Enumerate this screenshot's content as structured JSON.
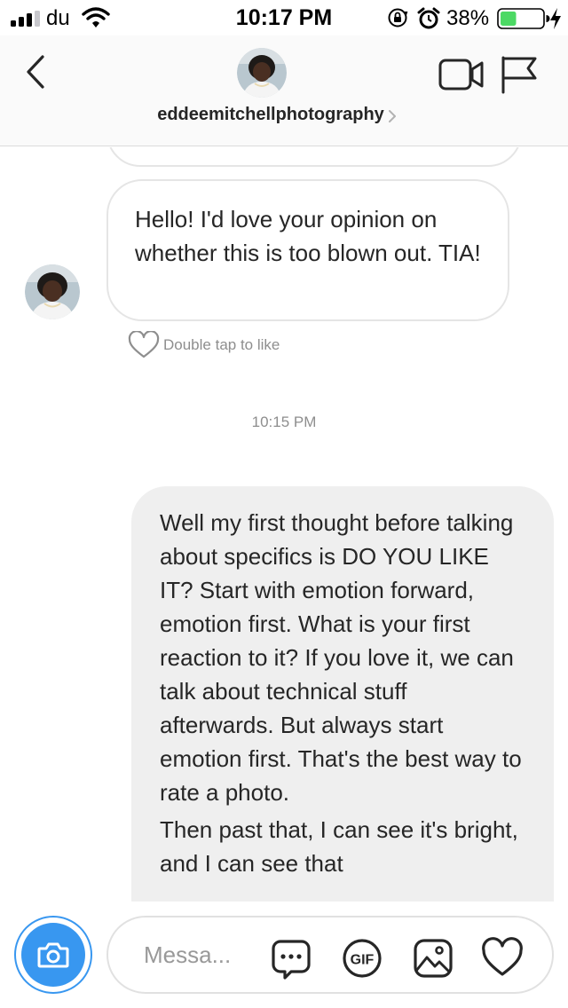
{
  "status_bar": {
    "carrier": "du",
    "time": "10:17 PM",
    "battery_percent": "38%",
    "battery_level": 0.38,
    "battery_color": "#4cd964",
    "icons": [
      "signal-icon",
      "wifi-icon",
      "rotation-lock-icon",
      "alarm-icon",
      "battery-icon",
      "charging-icon"
    ]
  },
  "header": {
    "username": "eddeemitchellphotography",
    "icons": [
      "back-chevron-icon",
      "avatar",
      "chevron-right-icon",
      "video-camera-icon",
      "flag-icon"
    ]
  },
  "conversation": {
    "received_message": "Hello! I'd love your opinion on whether this is too blown out. TIA!",
    "like_hint": "Double tap to like",
    "timestamp": "10:15 PM",
    "sent_message": {
      "paragraphs": [
        "Well my first thought before talking about specifics is DO YOU LIKE IT? Start with emotion forward, emotion first. What is your first reaction to it? If you love it, we can talk about technical stuff afterwards. But always start emotion first. That's the best way to rate a photo.",
        "Then past that, I can see it's bright, and I can see that"
      ]
    }
  },
  "composer": {
    "placeholder": "Messa...",
    "gif_label": "GIF",
    "accent_color": "#3897f0",
    "icons": [
      "camera-icon",
      "sticker-icon",
      "gif-icon",
      "gallery-icon",
      "heart-icon"
    ]
  }
}
